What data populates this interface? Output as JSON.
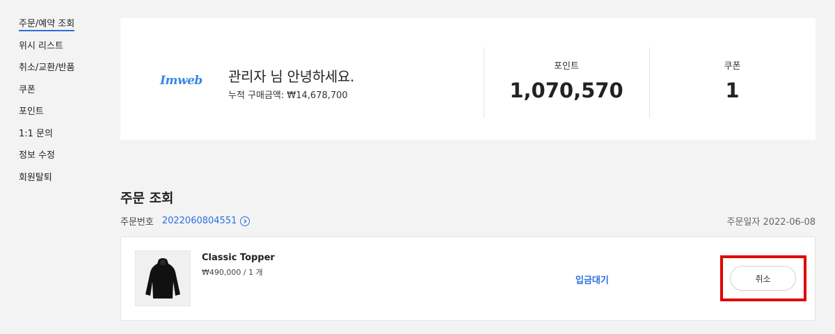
{
  "sidebar": {
    "items": [
      {
        "label": "주문/예약 조회",
        "active": true
      },
      {
        "label": "위시 리스트"
      },
      {
        "label": "취소/교환/반품"
      },
      {
        "label": "쿠폰"
      },
      {
        "label": "포인트"
      },
      {
        "label": "1:1 문의"
      },
      {
        "label": "정보 수정"
      },
      {
        "label": "회원탈퇴"
      }
    ]
  },
  "summary": {
    "logo": "Imweb",
    "greeting": "관리자 님 안녕하세요.",
    "total_purchase": "누적 구매금액: ₩14,678,700",
    "points_label": "포인트",
    "points_value": "1,070,570",
    "coupons_label": "쿠폰",
    "coupons_value": "1"
  },
  "order": {
    "section_title": "주문 조회",
    "order_number_label": "주문번호",
    "order_number": "2022060804551",
    "order_date": "주문일자 2022-06-08",
    "item": {
      "name": "Classic Topper",
      "price_qty": "₩490,000 / 1 개",
      "status": "입금대기",
      "cancel_label": "취소"
    }
  },
  "colors": {
    "accent": "#2a6ee0",
    "highlight": "#e00000",
    "background": "#f3f3f3"
  }
}
